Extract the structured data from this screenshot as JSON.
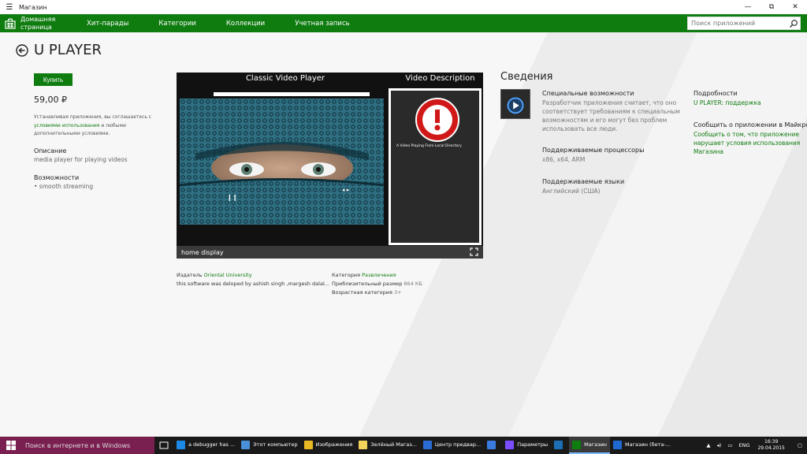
{
  "window": {
    "title": "Магазин",
    "minimize": "—",
    "restore": "⧉",
    "close": "✕"
  },
  "nav": {
    "home_line1": "Домашняя",
    "home_line2": "страница",
    "items": [
      "Хит-парады",
      "Категории",
      "Коллекции",
      "Учетная запись"
    ],
    "search_placeholder": "Поиск приложений"
  },
  "app": {
    "title": "U PLAYER",
    "buy_label": "Купить",
    "price": "59,00 ₽",
    "license_pre": "Устанавливая приложения, вы соглашаетесь с",
    "license_link": "условиями использования",
    "license_mid": " и любыми",
    "license_post": "дополнительными условиями.",
    "description_label": "Описание",
    "description_value": "media player for  playing videos",
    "features_label": "Возможности",
    "features_value": "•   smooth streaming"
  },
  "screenshot": {
    "header_left": "Classic Video Player",
    "header_right": "Video Description",
    "desc_text": "A Video Playing From Local Directory",
    "footer": "home display"
  },
  "meta": {
    "publisher_label": "Издатель",
    "publisher_value": "Oriental University",
    "dev_note": "this software was deloped by ashish singh ,margesh dalal...",
    "category_label": "Категория",
    "category_value": "Развлечения",
    "size_label": "Приблизительный размер",
    "size_value": "864 КБ",
    "age_label": "Возрастная категория",
    "age_value": "3+"
  },
  "info": {
    "header": "Сведения",
    "accessibility_title": "Специальные возможности",
    "accessibility_l1": "Разработчик приложения считает, что оно",
    "accessibility_l2": "соответствует требованиям к специальным",
    "accessibility_l3": "возможностям и его могут без проблем",
    "accessibility_l4": "использовать все люди.",
    "processors_title": "Поддерживаемые процессоры",
    "processors_value": "x86, x64, ARM",
    "languages_title": "Поддерживаемые языки",
    "languages_value": "Английский (США)",
    "details_title": "Подробности",
    "details_link": "U PLAYER: поддержка",
    "report_title": "Сообщить о приложении в Майкрософт",
    "report_l1": "Сообщить о том, что приложение",
    "report_l2": "нарушает условия использования",
    "report_l3": "Магазина"
  },
  "taskbar": {
    "search_text": "Поиск в интернете и в Windows",
    "items": [
      {
        "label": "a debugger has ...",
        "color": "#1e88e5"
      },
      {
        "label": "Этот компьютер",
        "color": "#4a90d9"
      },
      {
        "label": "Изображения",
        "color": "#e8b923"
      },
      {
        "label": "Зелёный Магаз...",
        "color": "#f3d35c"
      },
      {
        "label": "Центр предвар...",
        "color": "#2b6cd4"
      },
      {
        "label": "",
        "color": "#3b7be0"
      },
      {
        "label": "Параметры",
        "color": "#7c4dff"
      },
      {
        "label": "",
        "color": "#1c6fb5"
      },
      {
        "label": "Магазин",
        "color": "#0f7c10"
      },
      {
        "label": "Магазин (бета-...",
        "color": "#1e6ad0"
      }
    ],
    "lang": "ENG",
    "time": "16:39",
    "date": "29.04.2015"
  },
  "colors": {
    "accent": "#0f7c10",
    "taskbar_search": "#7a2050"
  }
}
